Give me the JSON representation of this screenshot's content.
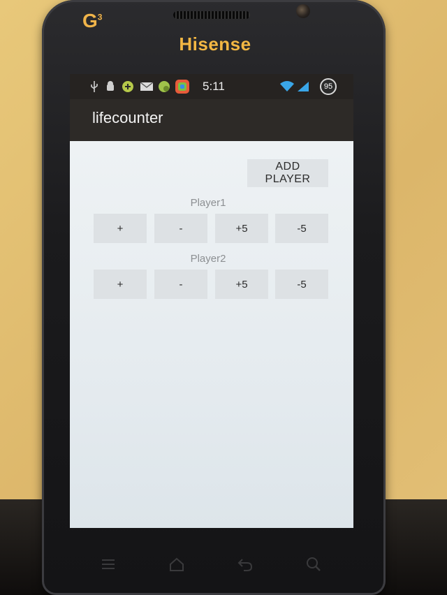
{
  "device": {
    "brand": "Hisense",
    "carrier_logo": "G",
    "carrier_logo_sup": "3"
  },
  "statusbar": {
    "time": "5:11",
    "battery": "95",
    "icons": [
      "usb-icon",
      "android-debug-icon",
      "game-icon",
      "mail-icon",
      "app-icon",
      "color-app-icon",
      "wifi-icon",
      "signal-icon"
    ]
  },
  "app": {
    "title": "lifecounter",
    "add_player_label": "ADD PLAYER",
    "players": [
      {
        "name": "Player1",
        "buttons": [
          "+",
          "-",
          "+5",
          "-5"
        ]
      },
      {
        "name": "Player2",
        "buttons": [
          "+",
          "-",
          "+5",
          "-5"
        ]
      }
    ]
  },
  "navbar": {
    "icons": [
      "menu-icon",
      "home-icon",
      "back-icon",
      "search-icon"
    ]
  }
}
